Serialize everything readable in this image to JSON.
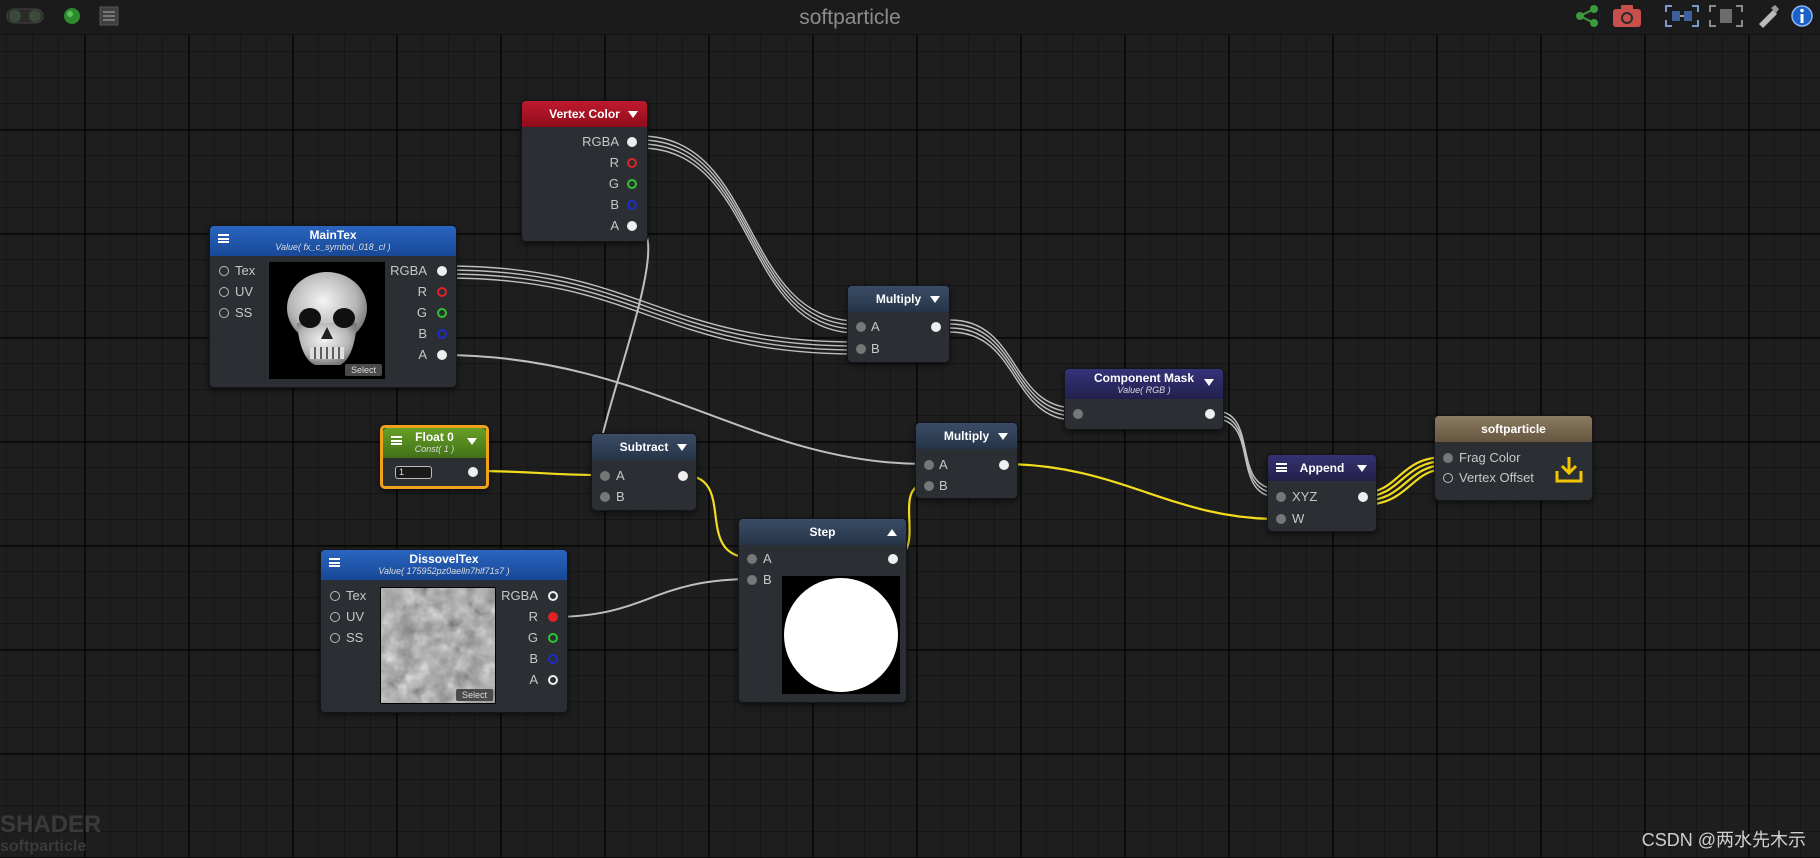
{
  "window": {
    "title": "softparticle"
  },
  "toolbar": {
    "left_icons": [
      "live-mode-toggle-icon",
      "status-led-icon",
      "options-panel-icon"
    ],
    "right_icons": [
      "share-icon",
      "screenshot-camera-icon",
      "focus-node-icon",
      "focus-selection-icon",
      "clean-up-icon",
      "info-icon"
    ]
  },
  "colors": {
    "vertex_color_header": "#a51023",
    "texture_header": "#1f55a8",
    "float_header": "#56861c",
    "float_border": "#f0a21a",
    "operation_header": "#2f3f55",
    "mask_header": "#2c2a58",
    "append_header": "#2d2a55",
    "output_header": "#7b6a55",
    "wire_yellow": "#f1dc1e",
    "wire_gray": "#b9b9b9"
  },
  "nodes": {
    "vertex_color": {
      "title": "Vertex Color",
      "outputs": [
        "RGBA",
        "R",
        "G",
        "B",
        "A"
      ]
    },
    "main_tex": {
      "title": "MainTex",
      "subtitle": "Value( fx_c_symbol_018_cl )",
      "inputs": [
        "Tex",
        "UV",
        "SS"
      ],
      "outputs": [
        "RGBA",
        "R",
        "G",
        "B",
        "A"
      ],
      "select_label": "Select"
    },
    "multiply_1": {
      "title": "Multiply",
      "inputs": [
        "A",
        "B"
      ]
    },
    "component_mask": {
      "title": "Component Mask",
      "subtitle": "Value( RGB )"
    },
    "float_0": {
      "title": "Float 0",
      "subtitle": "Const( 1 )",
      "value": "1"
    },
    "subtract": {
      "title": "Subtract",
      "inputs": [
        "A",
        "B"
      ]
    },
    "multiply_2": {
      "title": "Multiply",
      "inputs": [
        "A",
        "B"
      ]
    },
    "append": {
      "title": "Append",
      "inputs": [
        "XYZ",
        "W"
      ]
    },
    "output": {
      "title": "softparticle",
      "inputs": [
        "Frag Color",
        "Vertex Offset"
      ]
    },
    "step": {
      "title": "Step",
      "inputs": [
        "A",
        "B"
      ]
    },
    "dissovel_tex": {
      "title": "DissovelTex",
      "subtitle": "Value( 175952pz0aelln7hlf71s7 )",
      "inputs": [
        "Tex",
        "UV",
        "SS"
      ],
      "outputs": [
        "RGBA",
        "R",
        "G",
        "B",
        "A"
      ],
      "select_label": "Select"
    }
  },
  "watermark": {
    "line1": "SHADER",
    "line2": "softparticle"
  },
  "credit": "CSDN @两水先木示"
}
